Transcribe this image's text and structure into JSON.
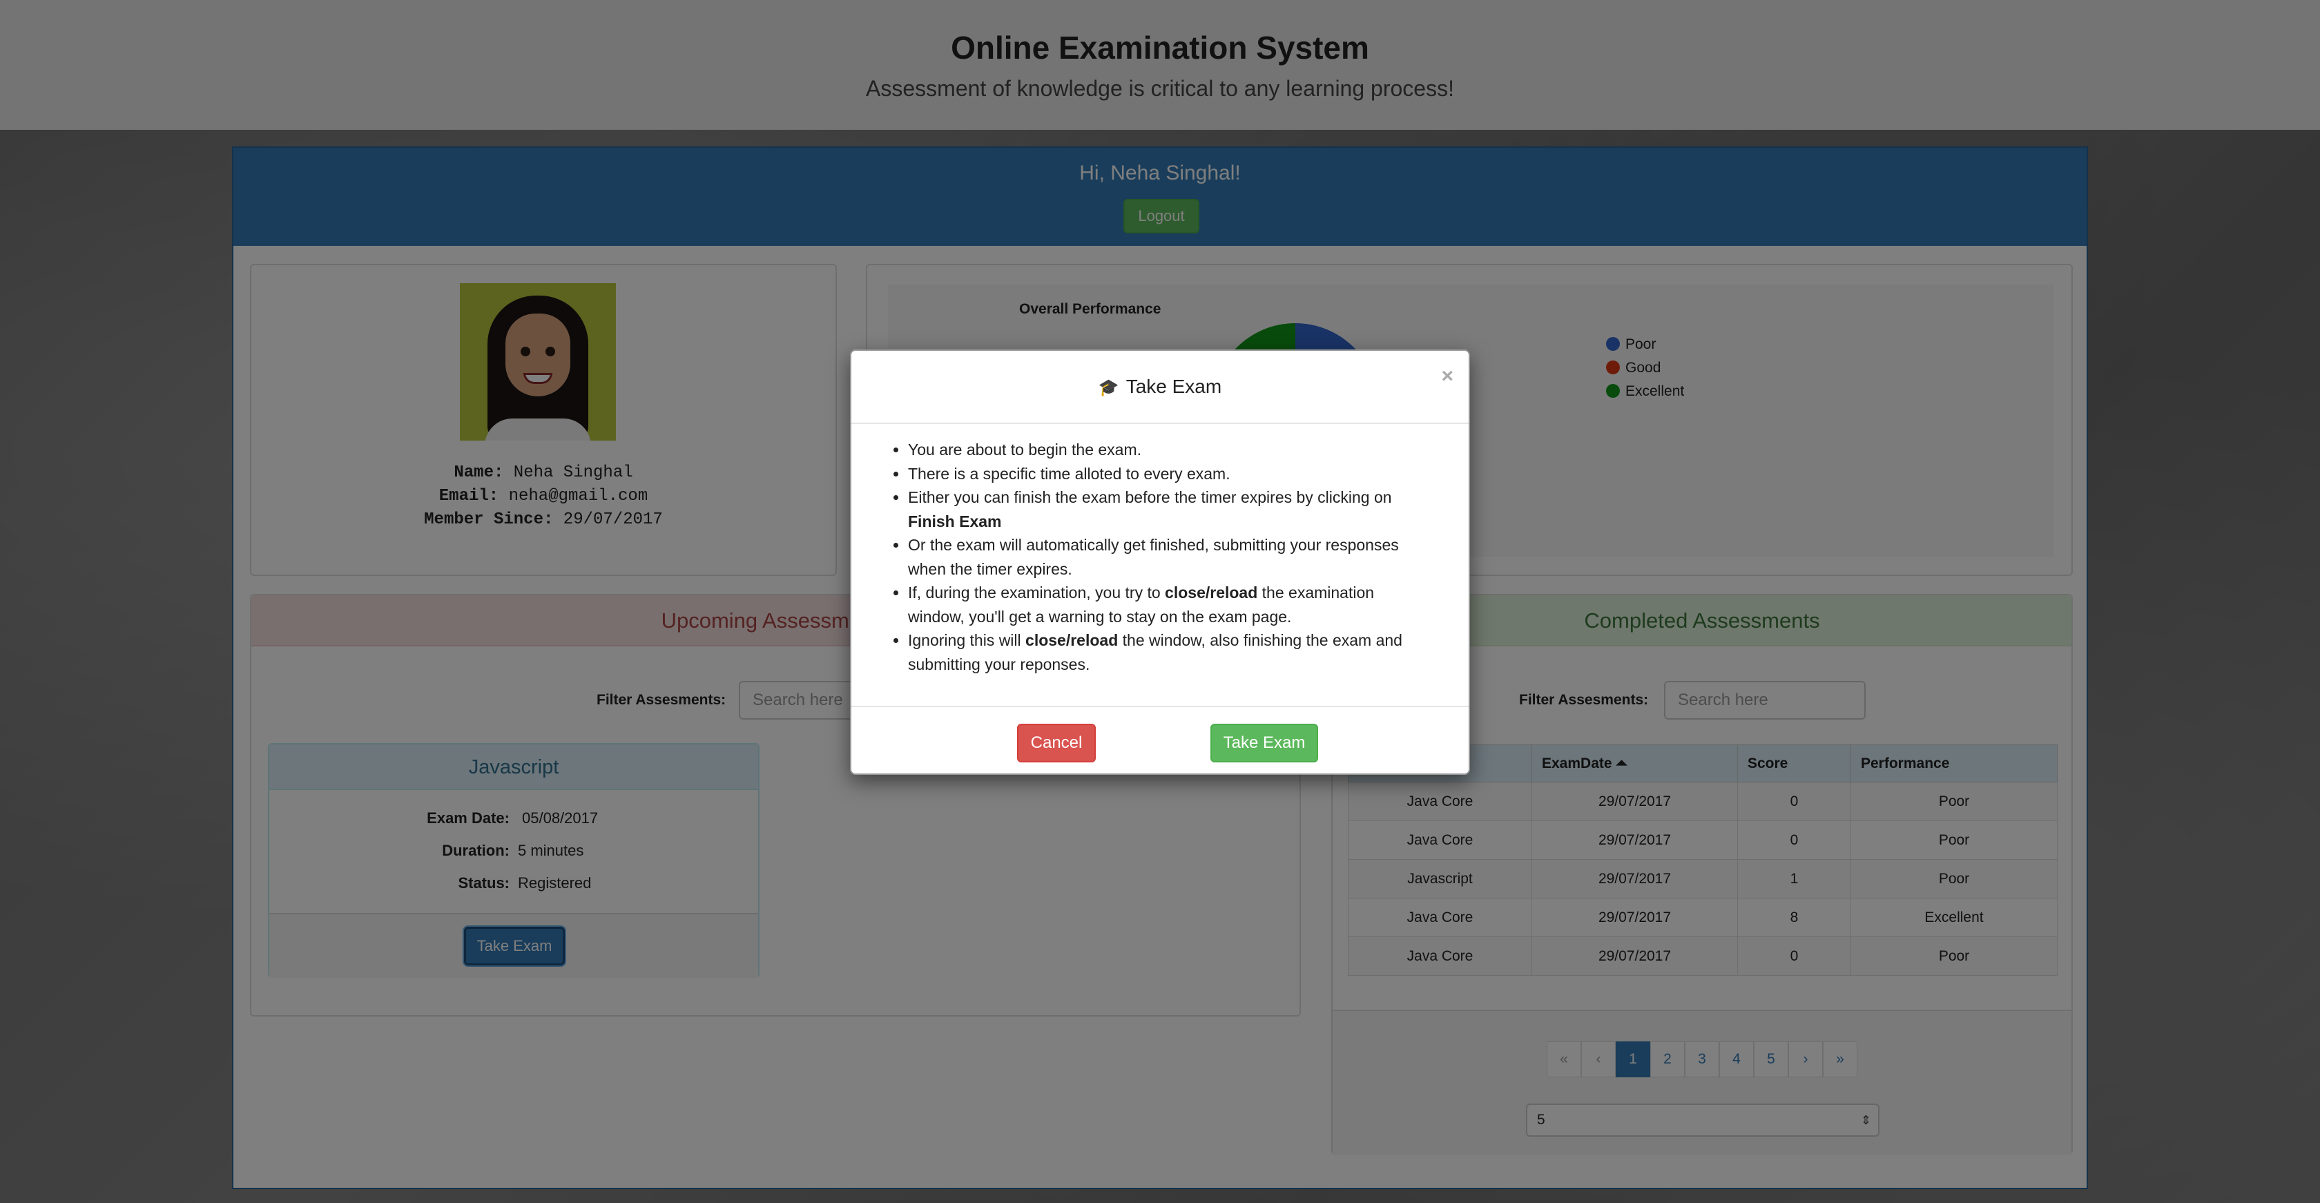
{
  "header": {
    "title": "Online Examination System",
    "subtitle": "Assessment of knowledge is critical to any learning process!"
  },
  "panel": {
    "greeting": "Hi, Neha Singhal!",
    "logout_label": "Logout"
  },
  "profile": {
    "name_label": "Name:",
    "name": "Neha Singhal",
    "email_label": "Email:",
    "email": "neha@gmail.com",
    "since_label": "Member Since:",
    "since": "29/07/2017"
  },
  "chart_data": {
    "type": "pie",
    "title": "Overall Performance",
    "legend_position": "right",
    "labels": [
      "Poor",
      "Good",
      "Excellent"
    ],
    "colors": [
      "#3366cc",
      "#dc3912",
      "#109618"
    ]
  },
  "upcoming": {
    "title": "Upcoming Assessments",
    "filter_label": "Filter Assesments:",
    "search_placeholder": "Search here",
    "card": {
      "title": "Javascript",
      "date_label": "Exam Date:",
      "date": "05/08/2017",
      "duration_label": "Duration:",
      "duration": "5 minutes",
      "status_label": "Status:",
      "status": "Registered",
      "take_label": "Take Exam"
    }
  },
  "completed": {
    "title": "Completed Assessments",
    "filter_label": "Filter Assesments:",
    "search_placeholder": "Search here",
    "columns": [
      "",
      "ExamDate ⏶",
      "Score",
      "Performance"
    ],
    "rows": [
      [
        "Java Core",
        "29/07/2017",
        "0",
        "Poor"
      ],
      [
        "Java Core",
        "29/07/2017",
        "0",
        "Poor"
      ],
      [
        "Javascript",
        "29/07/2017",
        "1",
        "Poor"
      ],
      [
        "Java Core",
        "29/07/2017",
        "8",
        "Excellent"
      ],
      [
        "Java Core",
        "29/07/2017",
        "0",
        "Poor"
      ]
    ],
    "pager": [
      "«",
      "‹",
      "1",
      "2",
      "3",
      "4",
      "5",
      "›",
      "»"
    ],
    "page_size": "5"
  },
  "modal": {
    "title": "Take Exam",
    "close": "×",
    "items": [
      "You are about to begin the exam.",
      "There is a specific time alloted to every exam.",
      "Either you can finish the exam before the timer expires by clicking on ",
      "Finish Exam",
      "Or the exam will automatically get finished, submitting your responses when the timer expires.",
      "If, during the examination, you try to ",
      "close/reload",
      " the examination window, you'll get a warning to stay on the exam page.",
      "Ignoring this will ",
      "close/reload",
      " the window, also finishing the exam and submitting your reponses."
    ],
    "cancel_label": "Cancel",
    "take_label": "Take Exam"
  }
}
